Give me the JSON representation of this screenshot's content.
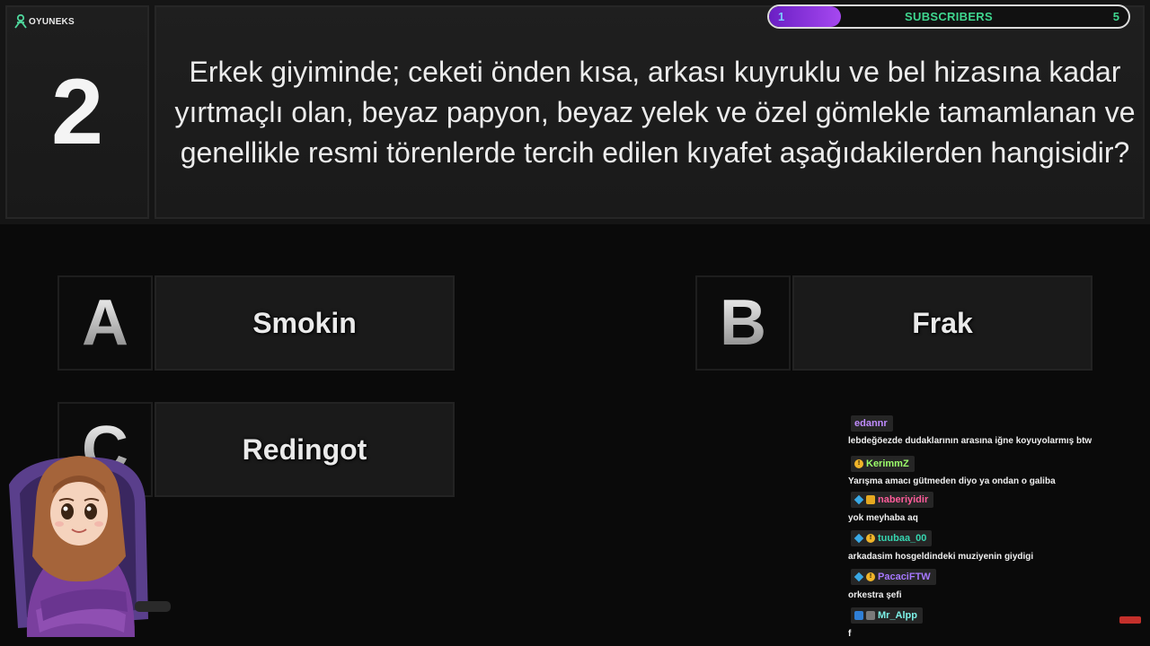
{
  "logo": {
    "text": "OYUNEKS",
    "sub": ""
  },
  "subscribers": {
    "current": "1",
    "goal": "5",
    "label": "SUBSCRIBERS",
    "progress_fraction": 0.2,
    "fill_color": "#8f35e6"
  },
  "question": {
    "number": "2",
    "text": "Erkek giyiminde; ceketi önden kısa, arkası kuyruklu ve bel hizasına kadar yırtmaçlı olan, beyaz papyon, beyaz yelek ve özel gömlekle tamamlanan ve genellikle resmi törenlerde tercih edilen kıyafet aşağıdakilerden hangisidir?"
  },
  "answers": [
    {
      "letter": "A",
      "text": "Smokin"
    },
    {
      "letter": "B",
      "text": "Frak"
    },
    {
      "letter": "C",
      "text": "Redingot"
    }
  ],
  "chat": [
    {
      "user": "edannr",
      "color": "#c08cff",
      "badges": [],
      "text": "lebdeğöezde dudaklarının arasına iğne koyuyolarmış btw"
    },
    {
      "user": "KerimmZ",
      "color": "#9cff6b",
      "badges": [
        "coin-icon"
      ],
      "text": "Yarışma amacı gütmeden diyo ya ondan o galiba"
    },
    {
      "user": "naberiyidir",
      "color": "#ff5c9a",
      "badges": [
        "gem-icon",
        "chest-icon"
      ],
      "text": "yok meyhaba aq"
    },
    {
      "user": "tuubaa_00",
      "color": "#36d6b0",
      "badges": [
        "gem-icon",
        "coin-icon"
      ],
      "text": "arkadasim hosgeldindeki muziyenin giydigi"
    },
    {
      "user": "PacaciFTW",
      "color": "#a678ff",
      "badges": [
        "gem-icon",
        "coin-icon"
      ],
      "text": "orkestra şefi"
    },
    {
      "user": "Mr_Alpp",
      "color": "#7cf0e6",
      "badges": [
        "mod-sword-icon",
        "wrench-icon"
      ],
      "text": "f"
    }
  ]
}
